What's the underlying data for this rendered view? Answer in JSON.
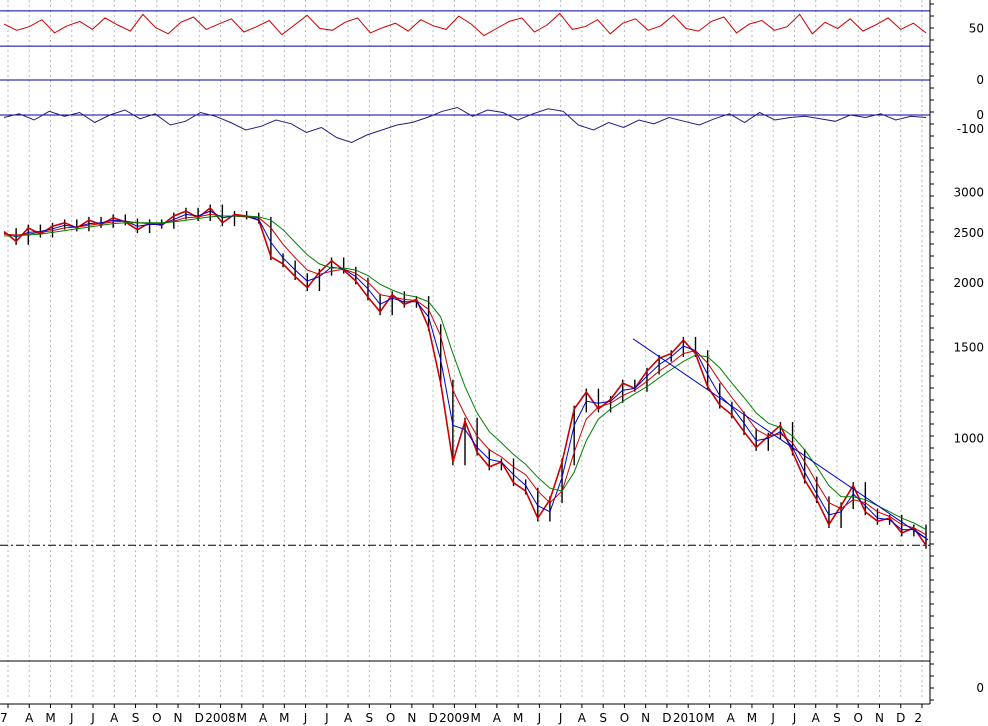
{
  "chart_data": {
    "type": "line",
    "panels": [
      {
        "id": "rsi",
        "type": "line",
        "y_ticks": [
          {
            "value": 50,
            "label": "50"
          }
        ],
        "levels": [
          70,
          30
        ],
        "ylim": [
          20,
          80
        ],
        "color": "#cc0000",
        "series": [
          {
            "values": [
              55,
              48,
              52,
              60,
              45,
              53,
              58,
              49,
              62,
              54,
              47,
              66,
              51,
              44,
              57,
              63,
              49,
              55,
              61,
              46,
              52,
              59,
              43,
              54,
              65,
              50,
              48,
              57,
              62,
              45,
              51,
              56,
              47,
              60,
              53,
              49,
              64,
              55,
              42,
              50,
              58,
              62,
              46,
              54,
              67,
              49,
              52,
              60,
              44,
              56,
              61,
              48,
              53,
              65,
              50,
              47,
              58,
              63,
              45,
              55,
              59,
              48,
              52,
              66,
              44,
              57,
              50,
              61,
              47,
              54,
              62,
              49,
              56,
              45
            ]
          }
        ]
      },
      {
        "id": "momentum",
        "type": "line",
        "y_ticks": [
          {
            "value": 0,
            "label": "0"
          },
          {
            "value": -100,
            "label": "-100"
          }
        ],
        "zero_lines": [
          {
            "value": 0,
            "label": "0"
          },
          {
            "value": 0,
            "label": "0"
          }
        ],
        "color": "#202080",
        "series": [
          {
            "values": [
              -10,
              5,
              -20,
              15,
              -5,
              10,
              -30,
              0,
              20,
              -15,
              5,
              -40,
              -25,
              10,
              -5,
              -30,
              -60,
              -45,
              -20,
              -35,
              -70,
              -50,
              -90,
              -110,
              -80,
              -60,
              -40,
              -30,
              -10,
              15,
              30,
              -5,
              20,
              10,
              -20,
              5,
              25,
              15,
              -40,
              -60,
              -30,
              -50,
              -20,
              -35,
              -10,
              -25,
              -40,
              -15,
              5,
              -30,
              10,
              -20,
              -10,
              -5,
              -15,
              -25,
              0,
              -10,
              5,
              -20,
              -5,
              -10
            ]
          }
        ]
      },
      {
        "id": "price",
        "type": "line",
        "scale": "log",
        "ylim": [
          450,
          3200
        ],
        "y_ticks": [
          {
            "value": 3000,
            "label": "3000"
          },
          {
            "value": 2500,
            "label": "2500"
          },
          {
            "value": 2000,
            "label": "2000"
          },
          {
            "value": 1500,
            "label": "1500"
          },
          {
            "value": 1000,
            "label": "1000"
          }
        ],
        "support_level": 620,
        "trendline": [
          {
            "x": 633,
            "y": 1560
          },
          {
            "x": 928,
            "y": 635
          }
        ],
        "series": [
          {
            "role": "price",
            "color": "#cc0000",
            "values": [
              2520,
              2410,
              2560,
              2490,
              2580,
              2620,
              2560,
              2650,
              2600,
              2680,
              2630,
              2540,
              2620,
              2590,
              2700,
              2760,
              2680,
              2800,
              2620,
              2720,
              2700,
              2650,
              2250,
              2180,
              2060,
              1960,
              2100,
              2210,
              2120,
              2020,
              1880,
              1760,
              1900,
              1820,
              1860,
              1640,
              1280,
              900,
              1080,
              940,
              880,
              900,
              820,
              790,
              700,
              760,
              900,
              1140,
              1230,
              1140,
              1190,
              1280,
              1250,
              1350,
              1430,
              1460,
              1550,
              1460,
              1260,
              1160,
              1110,
              1030,
              960,
              1010,
              1060,
              940,
              830,
              760,
              680,
              740,
              810,
              720,
              690,
              700,
              655,
              670,
              620
            ]
          },
          {
            "role": "ma-short",
            "color": "#0000cc",
            "values": [
              2500,
              2460,
              2510,
              2520,
              2550,
              2590,
              2570,
              2610,
              2620,
              2650,
              2640,
              2580,
              2600,
              2600,
              2660,
              2720,
              2700,
              2760,
              2680,
              2700,
              2690,
              2660,
              2400,
              2240,
              2120,
              2020,
              2060,
              2150,
              2130,
              2060,
              1950,
              1820,
              1870,
              1840,
              1840,
              1720,
              1420,
              1060,
              1040,
              960,
              910,
              900,
              850,
              810,
              740,
              720,
              840,
              1060,
              1180,
              1170,
              1180,
              1240,
              1250,
              1320,
              1390,
              1440,
              1510,
              1480,
              1330,
              1210,
              1150,
              1070,
              990,
              1000,
              1030,
              960,
              860,
              780,
              710,
              720,
              780,
              740,
              700,
              695,
              665,
              665,
              640
            ]
          },
          {
            "role": "ma-medium",
            "color": "#cc0000",
            "values": [
              2490,
              2480,
              2490,
              2510,
              2530,
              2560,
              2570,
              2590,
              2610,
              2630,
              2640,
              2620,
              2610,
              2610,
              2640,
              2680,
              2690,
              2720,
              2700,
              2700,
              2690,
              2680,
              2560,
              2380,
              2240,
              2120,
              2080,
              2110,
              2130,
              2090,
              2010,
              1900,
              1880,
              1860,
              1850,
              1780,
              1580,
              1240,
              1110,
              1010,
              950,
              920,
              880,
              850,
              790,
              750,
              790,
              940,
              1090,
              1150,
              1170,
              1210,
              1240,
              1290,
              1350,
              1400,
              1460,
              1480,
              1400,
              1290,
              1200,
              1120,
              1040,
              1010,
              1020,
              980,
              900,
              820,
              750,
              730,
              760,
              750,
              720,
              705,
              680,
              670,
              650
            ]
          },
          {
            "role": "ma-long",
            "color": "#008000",
            "values": [
              2470,
              2470,
              2480,
              2490,
              2510,
              2530,
              2550,
              2570,
              2590,
              2610,
              2620,
              2620,
              2620,
              2620,
              2630,
              2650,
              2670,
              2690,
              2700,
              2700,
              2700,
              2690,
              2650,
              2540,
              2400,
              2270,
              2180,
              2140,
              2140,
              2120,
              2070,
              1990,
              1940,
              1900,
              1880,
              1840,
              1720,
              1460,
              1260,
              1120,
              1030,
              980,
              930,
              890,
              840,
              800,
              790,
              860,
              990,
              1090,
              1140,
              1180,
              1220,
              1260,
              1310,
              1360,
              1410,
              1450,
              1440,
              1370,
              1280,
              1200,
              1120,
              1070,
              1050,
              1010,
              950,
              880,
              810,
              770,
              770,
              760,
              740,
              720,
              700,
              685,
              665
            ]
          }
        ]
      },
      {
        "id": "volume",
        "type": "line",
        "y_ticks": [
          {
            "value": 0,
            "label": "0"
          }
        ]
      }
    ],
    "x_axis": {
      "ticks": [
        "7",
        "A",
        "M",
        "J",
        "J",
        "A",
        "S",
        "O",
        "N",
        "D",
        "2008",
        "M",
        "A",
        "M",
        "J",
        "J",
        "A",
        "S",
        "O",
        "N",
        "D",
        "2009",
        "M",
        "A",
        "M",
        "J",
        "J",
        "A",
        "S",
        "O",
        "N",
        "D",
        "2010",
        "M",
        "A",
        "M",
        "J",
        "J",
        "A",
        "S",
        "O",
        "N",
        "D",
        "2"
      ]
    }
  }
}
